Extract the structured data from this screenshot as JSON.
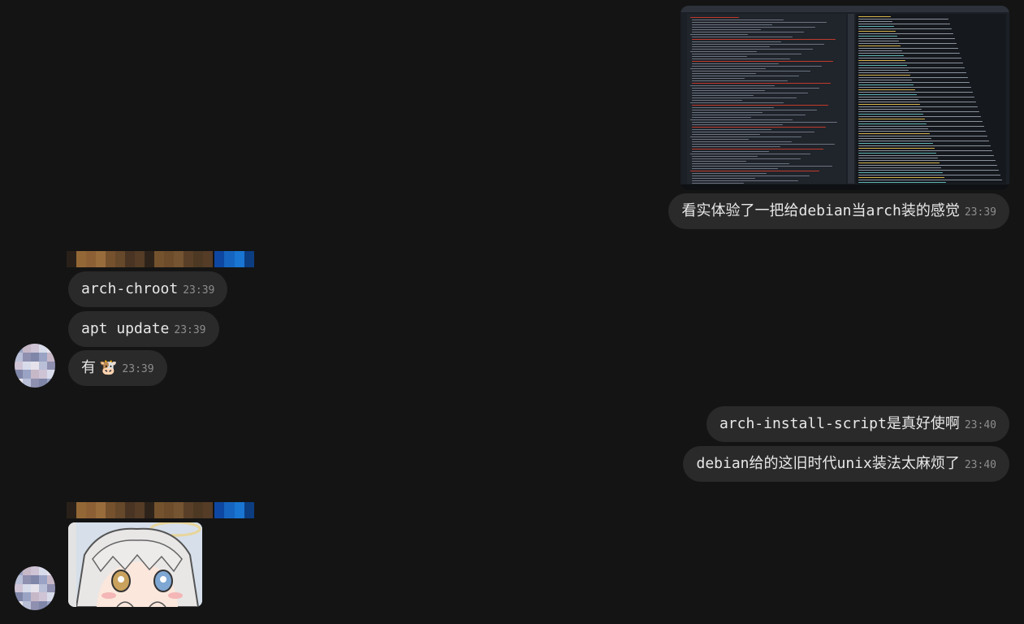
{
  "messages": {
    "m1": {
      "text": "看实体验了一把给debian当arch装的感觉",
      "time": "23:39"
    },
    "m2": {
      "text": "arch-chroot",
      "time": "23:39"
    },
    "m3": {
      "text": "apt update",
      "time": "23:39"
    },
    "m4": {
      "text": "有",
      "emoji": "🐮",
      "time": "23:39"
    },
    "m5": {
      "text": "arch-install-script是真好使啊",
      "time": "23:40"
    },
    "m6": {
      "text": "debian给的这旧时代unix装法太麻烦了",
      "time": "23:40"
    }
  },
  "colors": {
    "background": "#141414",
    "bubble": "#2a2a2a",
    "timestamp": "#8d8d8d",
    "tag_blue": "#1565c0"
  },
  "icons": {
    "avatar": "pixelated-avatar",
    "sticker": "anime-girl-sticker",
    "emoji": "cow-face"
  }
}
